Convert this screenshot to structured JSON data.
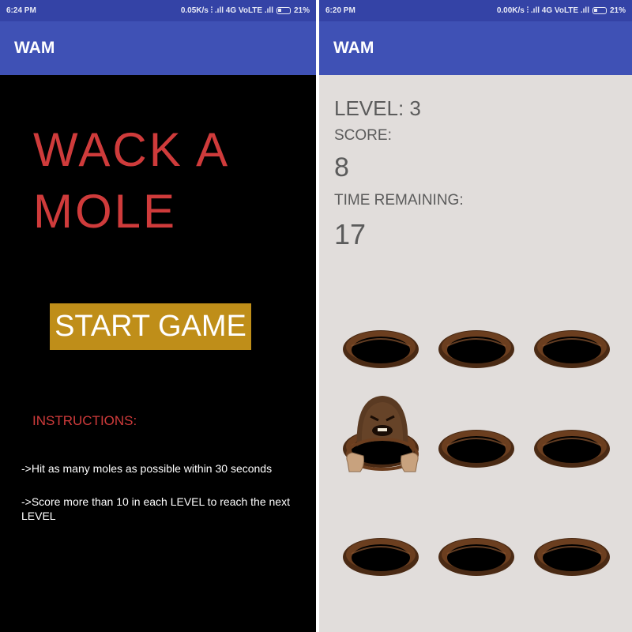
{
  "left": {
    "status": {
      "time": "6:24 PM",
      "network": "0.05K/s ⫶ .ıll 4G VoLTE .ıll",
      "battery": "21%"
    },
    "app_title": "WAM",
    "game_title": "WACK  A MOLE",
    "start_label": "START GAME",
    "instructions_title": "INSTRUCTIONS:",
    "instructions": [
      "->Hit as many moles as possible within 30 seconds",
      "->Score more than 10 in each LEVEL to reach the next LEVEL"
    ]
  },
  "right": {
    "status": {
      "time": "6:20 PM",
      "network": "0.00K/s ⫶ .ıll 4G VoLTE .ıll",
      "battery": "21%"
    },
    "app_title": "WAM",
    "level": "LEVEL: 3",
    "score_label": "SCORE:",
    "score": "8",
    "time_label": "TIME REMAINING:",
    "time": "17",
    "mole_hole": 3
  },
  "colors": {
    "status_bar": "#3443a6",
    "app_bar": "#3f51b5",
    "title_red": "#cf3b3b",
    "start_button": "#bf8e19",
    "game_bg": "#e1dddb"
  }
}
